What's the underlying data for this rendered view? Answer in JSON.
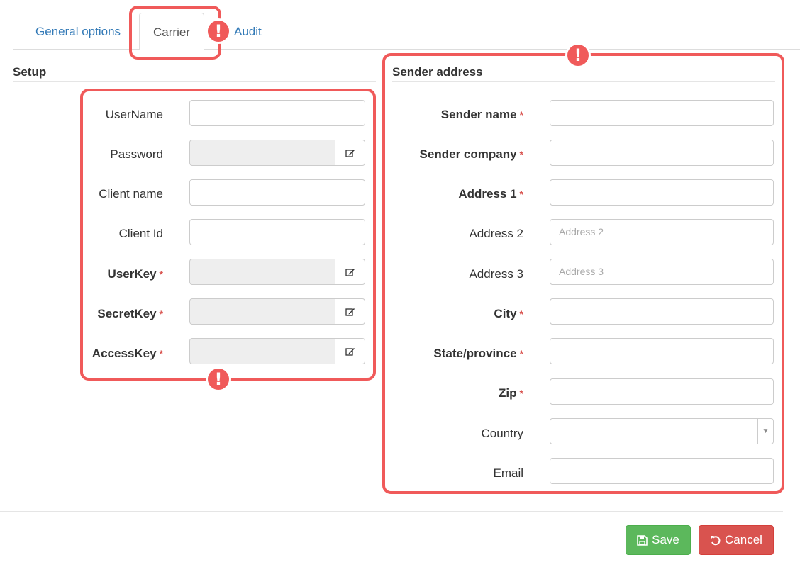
{
  "tabs": {
    "general": "General options",
    "carrier": "Carrier",
    "audit": "Audit"
  },
  "setup": {
    "title": "Setup",
    "fields": {
      "username": {
        "label": "UserName",
        "value": ""
      },
      "password": {
        "label": "Password",
        "value": ""
      },
      "client_name": {
        "label": "Client name",
        "value": ""
      },
      "client_id": {
        "label": "Client Id",
        "value": ""
      },
      "userkey": {
        "label": "UserKey",
        "value": ""
      },
      "secretkey": {
        "label": "SecretKey",
        "value": ""
      },
      "accesskey": {
        "label": "AccessKey",
        "value": ""
      }
    }
  },
  "sender": {
    "title": "Sender address",
    "fields": {
      "sender_name": {
        "label": "Sender name",
        "value": ""
      },
      "sender_company": {
        "label": "Sender company",
        "value": ""
      },
      "address1": {
        "label": "Address 1",
        "value": ""
      },
      "address2": {
        "label": "Address 2",
        "placeholder": "Address 2"
      },
      "address3": {
        "label": "Address 3",
        "placeholder": "Address 3"
      },
      "city": {
        "label": "City",
        "value": ""
      },
      "state": {
        "label": "State/province",
        "value": ""
      },
      "zip": {
        "label": "Zip",
        "value": ""
      },
      "country": {
        "label": "Country",
        "value": ""
      },
      "email": {
        "label": "Email",
        "value": ""
      }
    }
  },
  "required_mark": "*",
  "warning_mark": "!",
  "buttons": {
    "save": "Save",
    "cancel": "Cancel"
  },
  "colors": {
    "callout": "#f05a5a",
    "link": "#337ab7",
    "required": "#d9534f",
    "save": "#5cb85c",
    "cancel": "#d9534f"
  },
  "icons": {
    "edit": "edit-icon",
    "save": "floppy-disk-icon",
    "cancel": "undo-icon",
    "dropdown": "caret-down-icon",
    "warning": "exclamation-icon"
  }
}
